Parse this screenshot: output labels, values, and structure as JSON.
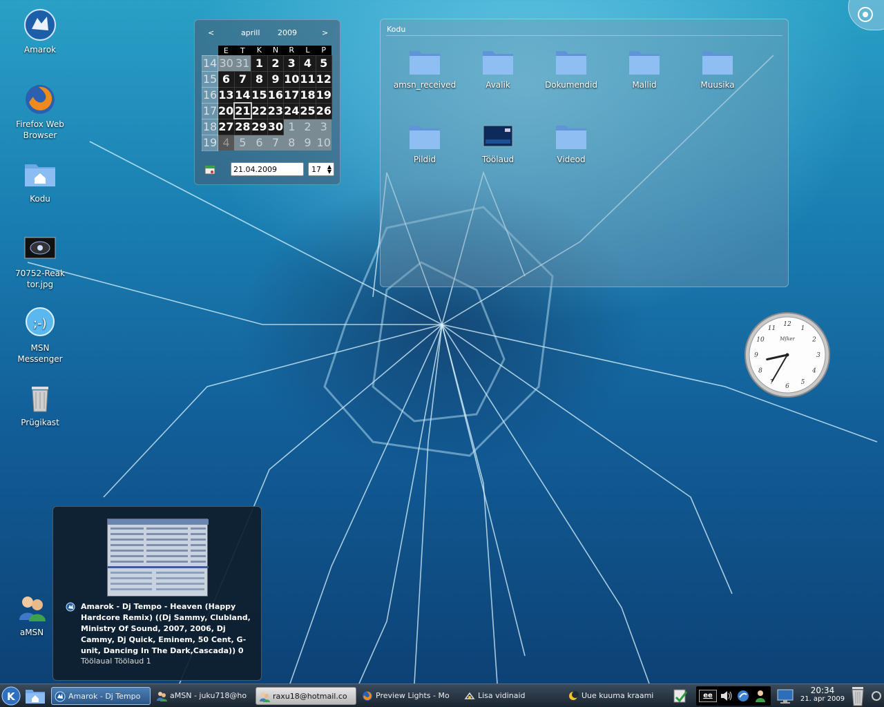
{
  "desktop_icons": [
    {
      "label": "Amarok",
      "icon": "amarok-wolf-icon"
    },
    {
      "label": "Firefox Web Browser",
      "icon": "firefox-icon"
    },
    {
      "label": "Kodu",
      "icon": "home-folder-icon"
    },
    {
      "label": "70752-Reaktor.jpg",
      "icon": "image-file-icon"
    },
    {
      "label": "MSN Messenger",
      "icon": "msn-messenger-icon"
    },
    {
      "label": "Prügikast",
      "icon": "trash-icon"
    },
    {
      "label": "aMSN",
      "icon": "amsn-users-icon"
    }
  ],
  "calendar": {
    "prev": "<",
    "next": ">",
    "month": "aprill",
    "year": "2009",
    "weekdays": [
      "E",
      "T",
      "K",
      "N",
      "R",
      "L",
      "P"
    ],
    "weeks": [
      {
        "wk": "14",
        "days": [
          "30",
          "31",
          "1",
          "2",
          "3",
          "4",
          "5"
        ]
      },
      {
        "wk": "15",
        "days": [
          "6",
          "7",
          "8",
          "9",
          "10",
          "11",
          "12"
        ]
      },
      {
        "wk": "16",
        "days": [
          "13",
          "14",
          "15",
          "16",
          "17",
          "18",
          "19"
        ]
      },
      {
        "wk": "17",
        "days": [
          "20",
          "21",
          "22",
          "23",
          "24",
          "25",
          "26"
        ]
      },
      {
        "wk": "18",
        "days": [
          "27",
          "28",
          "29",
          "30",
          "1",
          "2",
          "3"
        ]
      },
      {
        "wk": "19",
        "days": [
          "4",
          "5",
          "6",
          "7",
          "8",
          "9",
          "10"
        ]
      }
    ],
    "selected_date": "21.04.2009",
    "week_number": "17"
  },
  "folder_view": {
    "title": "Kodu",
    "items": [
      {
        "label": "amsn_received",
        "icon": "folder-icon"
      },
      {
        "label": "Avalik",
        "icon": "folder-icon"
      },
      {
        "label": "Dokumendid",
        "icon": "folder-icon"
      },
      {
        "label": "Mallid",
        "icon": "folder-icon"
      },
      {
        "label": "Muusika",
        "icon": "folder-icon"
      },
      {
        "label": "Pildid",
        "icon": "folder-icon"
      },
      {
        "label": "Töölaud",
        "icon": "desktop-folder-icon"
      },
      {
        "label": "Videod",
        "icon": "folder-icon"
      }
    ]
  },
  "clock": {
    "brand": "Mfker",
    "hour": 8,
    "minute": 35
  },
  "popup": {
    "title": "Amarok - Dj Tempo - Heaven (Happy Hardcore Remix) ((Dj Sammy, Clubland, Ministry Of Sound, 2007, 2006, Dj Cammy, Dj Quick, Eminem, 50 Cent, G-unit, Dancing In The Dark,Cascada)) 0",
    "subtitle": "Töölaual Töölaud 1"
  },
  "taskbar": {
    "tasks": [
      {
        "label": "Amarok - Dj Tempo",
        "style": "active"
      },
      {
        "label": "aMSN - juku718@ho",
        "style": "dark"
      },
      {
        "label": "raxu18@hotmail.co",
        "style": "light"
      },
      {
        "label": "Preview Lights - Mo",
        "style": "dark"
      },
      {
        "label": "Lisa vidinaid",
        "style": "dark"
      },
      {
        "label": "Uue kuuma kraami",
        "style": "dark"
      }
    ],
    "keyboard_layout": "ee",
    "time": "20:34",
    "date": "21. apr 2009"
  }
}
